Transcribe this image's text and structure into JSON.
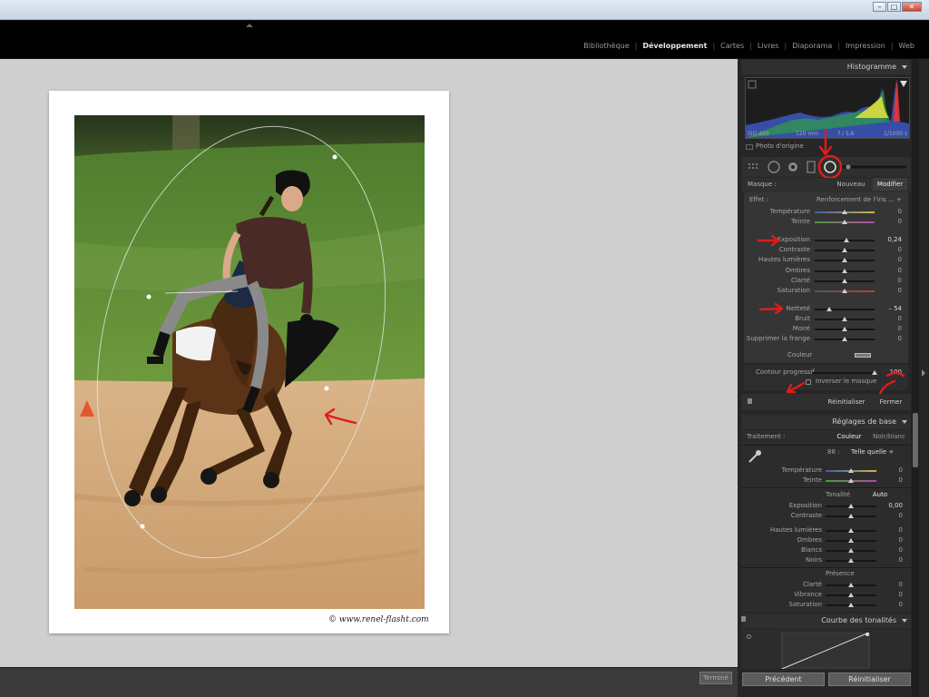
{
  "window": {
    "buttons": [
      "–",
      "□",
      "✕"
    ]
  },
  "modules": [
    "Bibliothèque",
    "Développement",
    "Cartes",
    "Livres",
    "Diaporama",
    "Impression",
    "Web"
  ],
  "module_separator": "|",
  "active_module": "Développement",
  "photo": {
    "watermark": "© www.renel-flasht.com"
  },
  "bottombar": {
    "done_label": "Terminé"
  },
  "histogram": {
    "title": "Histogramme",
    "iso": "ISO 400",
    "focal": "120 mm",
    "aperture": "f / 5,6",
    "shutter": "1/1000 s",
    "original_photo_label": "Photo d'origine"
  },
  "mask": {
    "label": "Masque :",
    "new_label": "Nouveau",
    "edit_label": "Modifier",
    "effect_label": "Effet :",
    "effect_value": "Renforcement de l'iris ... ÷",
    "sliders": [
      {
        "label": "Température",
        "value": "0",
        "pos": 0.5
      },
      {
        "label": "Teinte",
        "value": "0",
        "pos": 0.5
      },
      {
        "label": "Exposition",
        "value": "0,24",
        "pos": 0.53
      },
      {
        "label": "Contraste",
        "value": "0",
        "pos": 0.5
      },
      {
        "label": "Hautes lumières",
        "value": "0",
        "pos": 0.5
      },
      {
        "label": "Ombres",
        "value": "0",
        "pos": 0.5
      },
      {
        "label": "Clarté",
        "value": "0",
        "pos": 0.5
      },
      {
        "label": "Saturation",
        "value": "0",
        "pos": 0.5
      },
      {
        "label": "Netteté",
        "value": "– 54",
        "pos": 0.24
      },
      {
        "label": "Bruit",
        "value": "0",
        "pos": 0.5
      },
      {
        "label": "Moiré",
        "value": "0",
        "pos": 0.5
      },
      {
        "label": "Supprimer la frange",
        "value": "0",
        "pos": 0.5
      }
    ],
    "color_label": "Couleur",
    "feather_label": "Contour progressif",
    "feather_value": "100",
    "feather_pos": 1.0,
    "invert_label": "Inverser le masque",
    "reset_label": "Réinitialiser",
    "close_label": "Fermer"
  },
  "basic": {
    "title": "Réglages de base",
    "treatment_label": "Traitement :",
    "color_option": "Couleur",
    "bw_option": "Noir/blanc",
    "wb_as_shot_code": "88 :",
    "wb_value": "Telle quelle ÷",
    "wb_sliders": [
      {
        "label": "Température",
        "value": "0",
        "pos": 0.5
      },
      {
        "label": "Teinte",
        "value": "0",
        "pos": 0.5
      }
    ],
    "tone_label": "Tonalité",
    "auto_label": "Auto",
    "tone_sliders": [
      {
        "label": "Exposition",
        "value": "0,00",
        "pos": 0.5
      },
      {
        "label": "Contraste",
        "value": "0",
        "pos": 0.5
      },
      {
        "label": "Hautes lumières",
        "value": "0",
        "pos": 0.5
      },
      {
        "label": "Ombres",
        "value": "0",
        "pos": 0.5
      },
      {
        "label": "Blancs",
        "value": "0",
        "pos": 0.5
      },
      {
        "label": "Noirs",
        "value": "0",
        "pos": 0.5
      }
    ],
    "presence_label": "Présence",
    "presence_sliders": [
      {
        "label": "Clarté",
        "value": "0",
        "pos": 0.5
      },
      {
        "label": "Vibrance",
        "value": "0",
        "pos": 0.5
      },
      {
        "label": "Saturation",
        "value": "0",
        "pos": 0.5
      }
    ]
  },
  "curve": {
    "title": "Courbe des tonalités"
  },
  "footer": {
    "previous_label": "Précédent",
    "reset_label": "Réinitialiser"
  },
  "colors": {
    "panel": "#262626",
    "canvas": "#cfcfcf",
    "annotation": "#e21b1b"
  }
}
